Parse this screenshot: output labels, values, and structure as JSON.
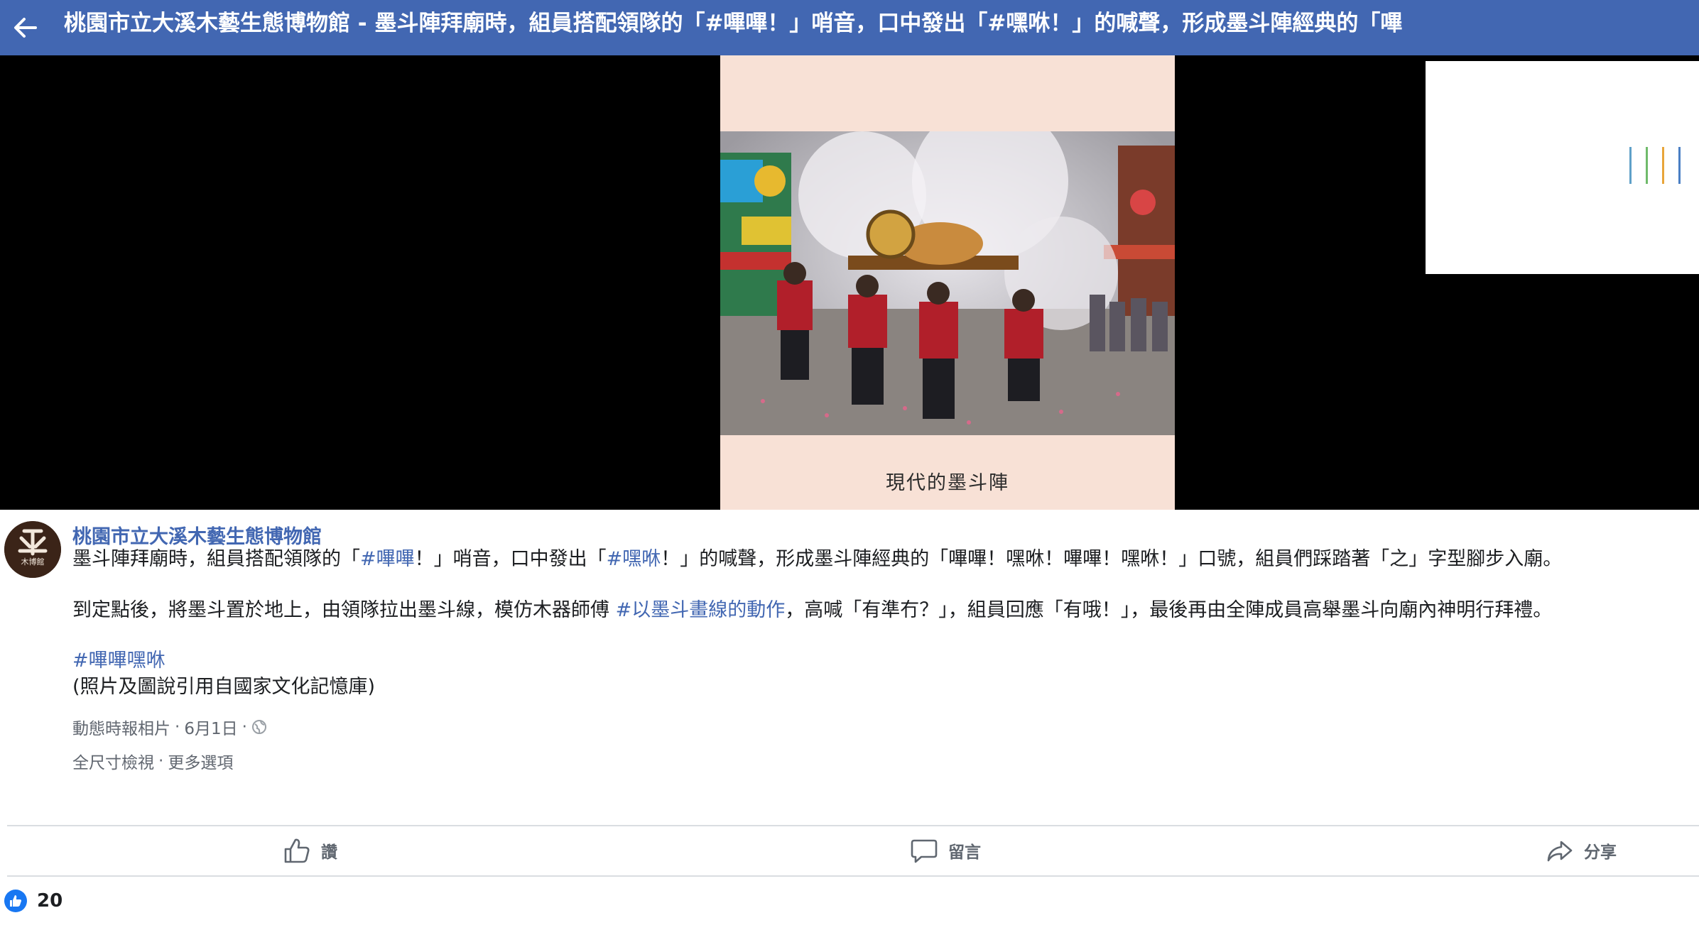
{
  "header": {
    "title": "桃園市立大溪木藝生態博物館 - 墨斗陣拜廟時，組員搭配領隊的「#嗶嗶！」哨音，口中發出「#嘿咻！」的喊聲，形成墨斗陣經典的「嗶"
  },
  "photo": {
    "caption": "現代的墨斗陣"
  },
  "post": {
    "page_name": "桃園市立大溪木藝生態博物館",
    "avatar_text": "木博館",
    "p1_before": "墨斗陣拜廟時，組員搭配領隊的「",
    "p1_tag1": "#嗶嗶",
    "p1_middle": "！」哨音，口中發出「",
    "p1_tag2": "#嘿咻",
    "p1_after": "！」的喊聲，形成墨斗陣經典的「嗶嗶！嘿咻！嗶嗶！嘿咻！」口號，組員們踩踏著「之」字型腳步入廟。",
    "p2_before": "到定點後，將墨斗置於地上，由領隊拉出墨斗線，模仿木器師傅 ",
    "p2_tag": "#以墨斗畫線的動作",
    "p2_after": "，高喊「有準冇？」，組員回應「有哦！」，最後再由全陣成員高舉墨斗向廟內神明行拜禮。",
    "hashtag": "#嗶嗶嘿咻",
    "source_note": "(照片及圖說引用自國家文化記憶庫)",
    "album": "動態時報相片",
    "date": "6月1日",
    "sep": "·",
    "full_size": "全尺寸檢視",
    "more_options": "更多選項"
  },
  "actions": {
    "like": "讚",
    "comment": "留言",
    "share": "分享"
  },
  "reactions": {
    "like_count": "20"
  },
  "colors": {
    "topbar": "#4267b2",
    "link": "#4267b2",
    "like_badge": "#1877f2",
    "photo_frame": "#f8e1d6"
  },
  "icons": {
    "back": "arrow-left-icon",
    "like": "thumbs-up-icon",
    "comment": "speech-bubble-icon",
    "share": "share-arrow-icon",
    "privacy": "globe-icon"
  }
}
